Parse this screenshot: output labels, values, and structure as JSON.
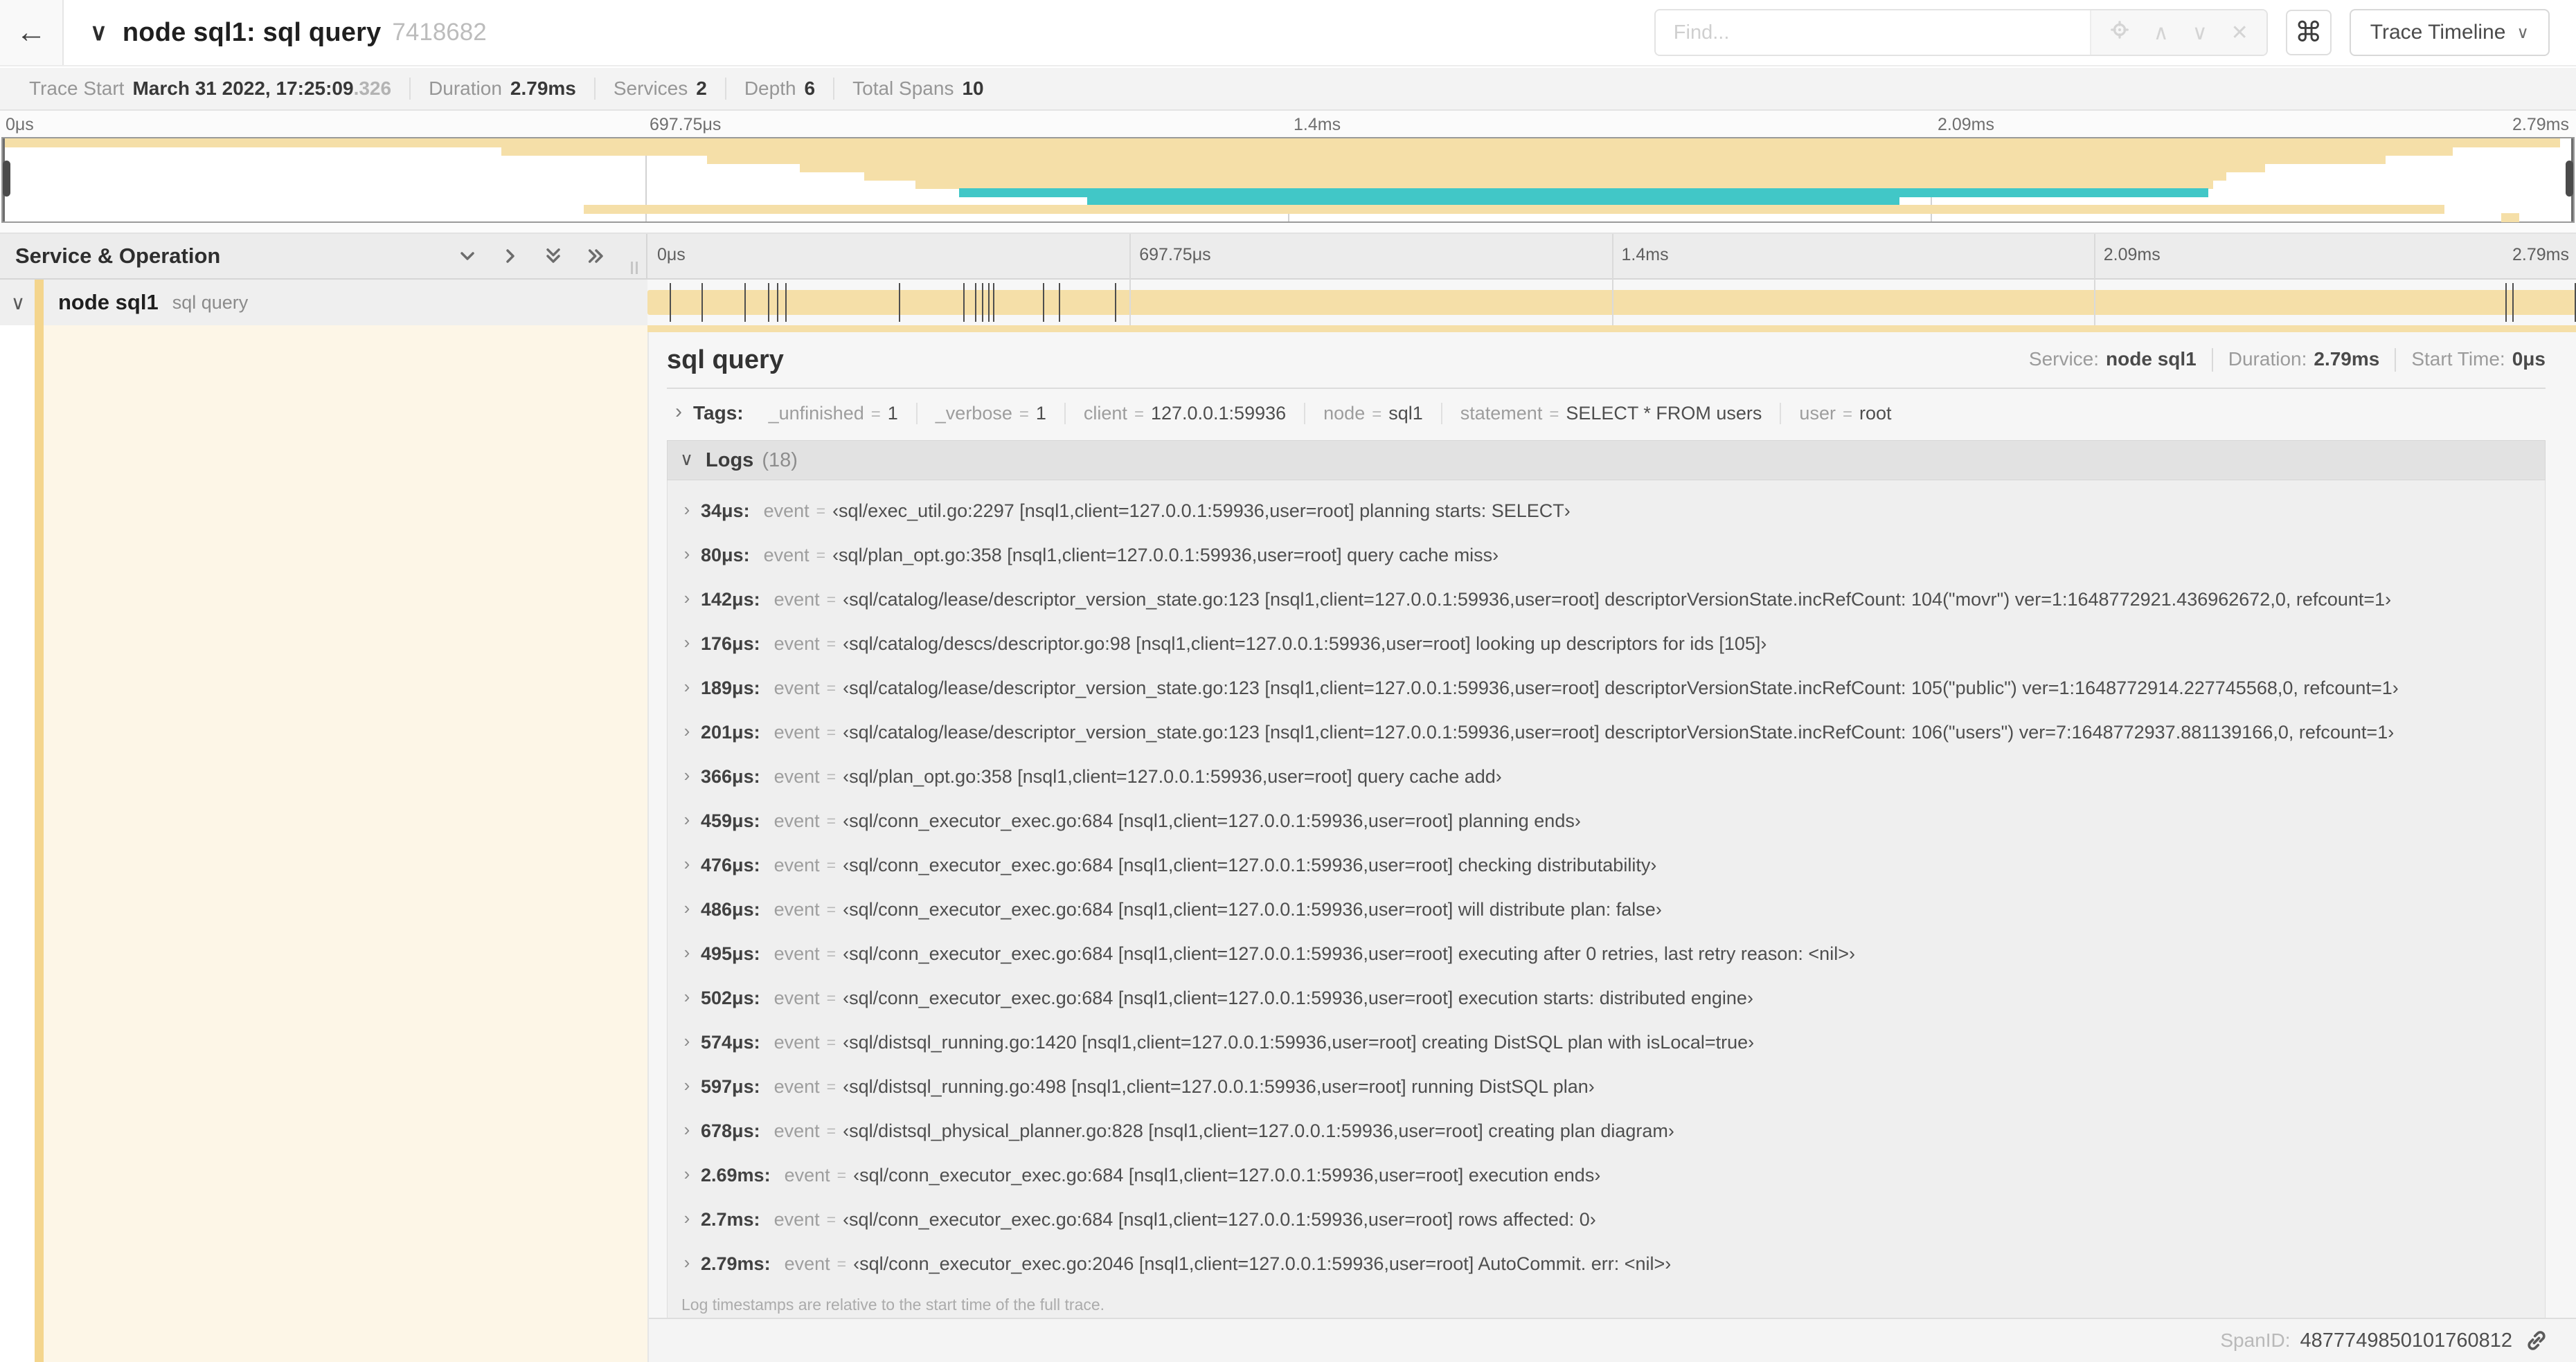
{
  "header": {
    "back_icon": "←",
    "collapse_icon": "∨",
    "title": "node sql1: sql query",
    "trace_id": "7418682",
    "find_placeholder": "Find...",
    "shortcut_icon": "⌘",
    "view_selector": "Trace Timeline",
    "view_selector_chevron": "∨"
  },
  "meta": [
    {
      "label": "Trace Start",
      "value": "March 31 2022, 17:25:09",
      "suffix": ".326"
    },
    {
      "label": "Duration",
      "value": "2.79ms"
    },
    {
      "label": "Services",
      "value": "2"
    },
    {
      "label": "Depth",
      "value": "6"
    },
    {
      "label": "Total Spans",
      "value": "10"
    }
  ],
  "timeline": {
    "total_us": 2790,
    "ticks": [
      "0μs",
      "697.75μs",
      "1.4ms",
      "2.09ms",
      "2.79ms"
    ],
    "left_header": "Service & Operation",
    "row": {
      "chevron": "∨",
      "service": "node sql1",
      "operation": "sql query"
    }
  },
  "minimap": {
    "rows": [
      {
        "start": 0,
        "end": 99.5,
        "color": "#F5DFA8"
      },
      {
        "start": 19.4,
        "end": 95.3,
        "color": "#F5DFA8"
      },
      {
        "start": 27.4,
        "end": 92.7,
        "color": "#F5DFA8"
      },
      {
        "start": 31.0,
        "end": 88.0,
        "color": "#F5DFA8"
      },
      {
        "start": 33.5,
        "end": 86.5,
        "color": "#F5DFA8"
      },
      {
        "start": 35.5,
        "end": 86.0,
        "color": "#F5DFA8"
      },
      {
        "start": 37.2,
        "end": 85.8,
        "color": "#41C7C7"
      },
      {
        "start": 42.2,
        "end": 73.8,
        "color": "#41C7C7"
      },
      {
        "start": 22.6,
        "end": 95.0,
        "color": "#F5DFA8"
      },
      {
        "start": 97.2,
        "end": 97.9,
        "color": "#F5DFA8"
      }
    ]
  },
  "colors": {
    "span_yellow": "#F5DFA8",
    "accent_stripe": "#F4D58D",
    "teal": "#41C7C7",
    "detail_cream": "#FDF6E7"
  },
  "detail": {
    "operation": "sql query",
    "service_label": "Service:",
    "service": "node sql1",
    "duration_label": "Duration:",
    "duration": "2.79ms",
    "start_label": "Start Time:",
    "start": "0μs",
    "tags_chevron": "›",
    "tags_label": "Tags:",
    "tags": [
      {
        "key": "_unfinished",
        "value": "1"
      },
      {
        "key": "_verbose",
        "value": "1"
      },
      {
        "key": "client",
        "value": "127.0.0.1:59936"
      },
      {
        "key": "node",
        "value": "sql1"
      },
      {
        "key": "statement",
        "value": "SELECT * FROM users"
      },
      {
        "key": "user",
        "value": "root"
      }
    ],
    "logs_chevron": "∨",
    "logs_label": "Logs",
    "logs_count": "(18)",
    "logs": [
      {
        "time": "34μs",
        "t_us": 34,
        "event": "‹sql/exec_util.go:2297 [nsql1,client=127.0.0.1:59936,user=root] planning starts: SELECT›"
      },
      {
        "time": "80μs",
        "t_us": 80,
        "event": "‹sql/plan_opt.go:358 [nsql1,client=127.0.0.1:59936,user=root] query cache miss›"
      },
      {
        "time": "142μs",
        "t_us": 142,
        "event": "‹sql/catalog/lease/descriptor_version_state.go:123 [nsql1,client=127.0.0.1:59936,user=root] descriptorVersionState.incRefCount: 104(\"movr\") ver=1:1648772921.436962672,0, refcount=1›"
      },
      {
        "time": "176μs",
        "t_us": 176,
        "event": "‹sql/catalog/descs/descriptor.go:98 [nsql1,client=127.0.0.1:59936,user=root] looking up descriptors for ids [105]›"
      },
      {
        "time": "189μs",
        "t_us": 189,
        "event": "‹sql/catalog/lease/descriptor_version_state.go:123 [nsql1,client=127.0.0.1:59936,user=root] descriptorVersionState.incRefCount: 105(\"public\") ver=1:1648772914.227745568,0, refcount=1›"
      },
      {
        "time": "201μs",
        "t_us": 201,
        "event": "‹sql/catalog/lease/descriptor_version_state.go:123 [nsql1,client=127.0.0.1:59936,user=root] descriptorVersionState.incRefCount: 106(\"users\") ver=7:1648772937.881139166,0, refcount=1›"
      },
      {
        "time": "366μs",
        "t_us": 366,
        "event": "‹sql/plan_opt.go:358 [nsql1,client=127.0.0.1:59936,user=root] query cache add›"
      },
      {
        "time": "459μs",
        "t_us": 459,
        "event": "‹sql/conn_executor_exec.go:684 [nsql1,client=127.0.0.1:59936,user=root] planning ends›"
      },
      {
        "time": "476μs",
        "t_us": 476,
        "event": "‹sql/conn_executor_exec.go:684 [nsql1,client=127.0.0.1:59936,user=root] checking distributability›"
      },
      {
        "time": "486μs",
        "t_us": 486,
        "event": "‹sql/conn_executor_exec.go:684 [nsql1,client=127.0.0.1:59936,user=root] will distribute plan: false›"
      },
      {
        "time": "495μs",
        "t_us": 495,
        "event": "‹sql/conn_executor_exec.go:684 [nsql1,client=127.0.0.1:59936,user=root] executing after 0 retries, last retry reason: <nil>›"
      },
      {
        "time": "502μs",
        "t_us": 502,
        "event": "‹sql/conn_executor_exec.go:684 [nsql1,client=127.0.0.1:59936,user=root] execution starts: distributed engine›"
      },
      {
        "time": "574μs",
        "t_us": 574,
        "event": "‹sql/distsql_running.go:1420 [nsql1,client=127.0.0.1:59936,user=root] creating DistSQL plan with isLocal=true›"
      },
      {
        "time": "597μs",
        "t_us": 597,
        "event": "‹sql/distsql_running.go:498 [nsql1,client=127.0.0.1:59936,user=root] running DistSQL plan›"
      },
      {
        "time": "678μs",
        "t_us": 678,
        "event": "‹sql/distsql_physical_planner.go:828 [nsql1,client=127.0.0.1:59936,user=root] creating plan diagram›"
      },
      {
        "time": "2.69ms",
        "t_us": 2690,
        "event": "‹sql/conn_executor_exec.go:684 [nsql1,client=127.0.0.1:59936,user=root] execution ends›"
      },
      {
        "time": "2.7ms",
        "t_us": 2700,
        "event": "‹sql/conn_executor_exec.go:684 [nsql1,client=127.0.0.1:59936,user=root] rows affected: 0›"
      },
      {
        "time": "2.79ms",
        "t_us": 2790,
        "event": "‹sql/conn_executor_exec.go:2046 [nsql1,client=127.0.0.1:59936,user=root] AutoCommit. err: <nil>›"
      }
    ],
    "logs_note": "Log timestamps are relative to the start time of the full trace.",
    "span_id_label": "SpanID:",
    "span_id": "4877749850101760812"
  }
}
